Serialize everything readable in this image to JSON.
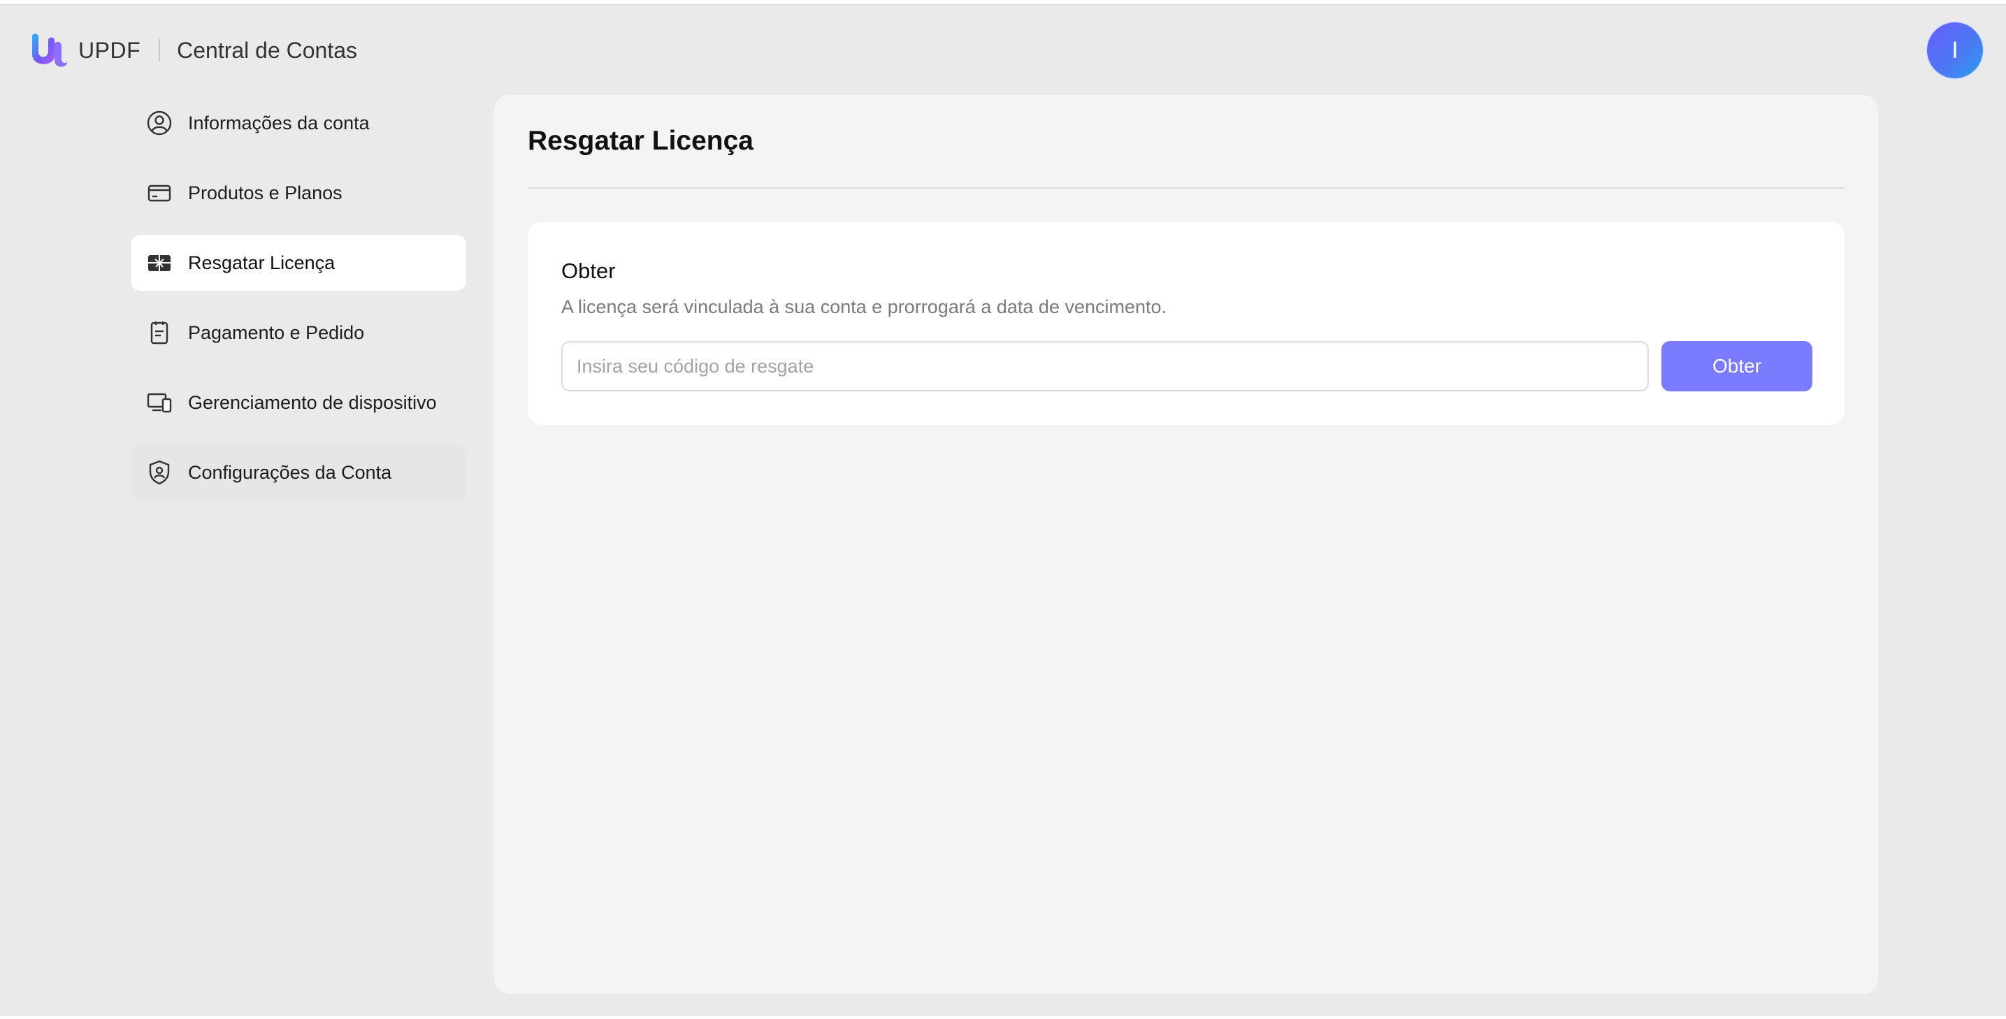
{
  "header": {
    "brand_name": "UPDF",
    "title": "Central de Contas",
    "avatar_initial": "I",
    "logo_icon": "updf-logo-icon"
  },
  "sidebar": {
    "items": [
      {
        "label": "Informações da conta",
        "icon": "user-circle-icon",
        "active": false
      },
      {
        "label": "Produtos e Planos",
        "icon": "credit-card-icon",
        "active": false
      },
      {
        "label": "Resgatar Licença",
        "icon": "gift-card-icon",
        "active": true
      },
      {
        "label": "Pagamento e Pedido",
        "icon": "clipboard-list-icon",
        "active": false
      },
      {
        "label": "Gerenciamento de dispositivo",
        "icon": "devices-icon",
        "active": false
      },
      {
        "label": "Configurações da Conta",
        "icon": "shield-user-icon",
        "active": false
      }
    ]
  },
  "main": {
    "title": "Resgatar Licença",
    "card": {
      "title": "Obter",
      "description": "A licença será vinculada à sua conta e prorrogará a data de vencimento.",
      "input_placeholder": "Insira seu código de resgate",
      "input_value": "",
      "button_label": "Obter"
    }
  },
  "colors": {
    "background": "#eaeaea",
    "panel": "#f4f4f4",
    "accent": "#7b7bff",
    "avatar_gradient_start": "#6a5cff",
    "avatar_gradient_end": "#2a9df0"
  }
}
